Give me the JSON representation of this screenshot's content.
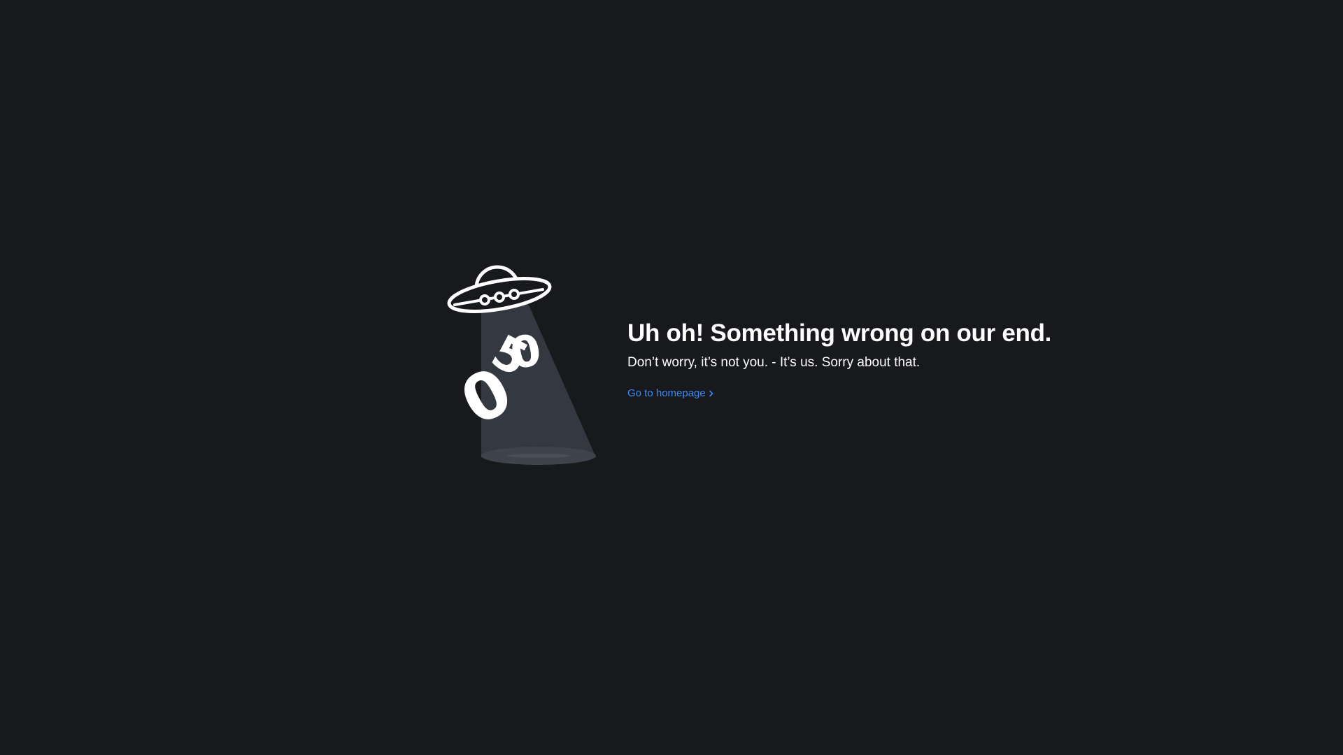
{
  "error": {
    "code_digits": [
      "5",
      "0",
      "0"
    ],
    "title": "Uh oh! Something wrong on our end.",
    "subtitle": "Don’t worry, it’s not you. - It’s us. Sorry about that.",
    "link_label": "Go to homepage",
    "link_icon": "chevron-right-icon"
  },
  "colors": {
    "background": "#17191d",
    "text": "#ffffff",
    "link": "#3b8bf4",
    "beam": "#343840",
    "beam_base": "#3f434b"
  }
}
